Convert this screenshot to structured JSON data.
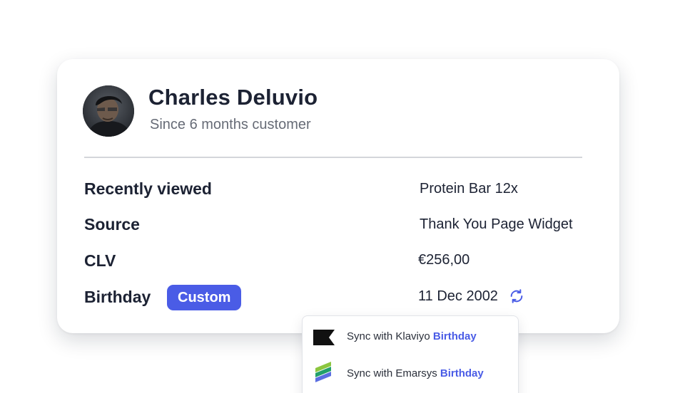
{
  "profile": {
    "name": "Charles Deluvio",
    "subtitle": "Since 6 months customer"
  },
  "fields": {
    "recently_viewed": {
      "label": "Recently viewed",
      "value": "Protein Bar 12x"
    },
    "source": {
      "label": "Source",
      "value": "Thank You Page Widget"
    },
    "clv": {
      "label": "CLV",
      "value": "€256,00"
    },
    "birthday": {
      "label": "Birthday",
      "badge": "Custom",
      "value": "11 Dec 2002"
    }
  },
  "sync_menu": {
    "items": [
      {
        "prefix": "Sync with Klaviyo",
        "field": "Birthday",
        "icon": "klaviyo-logo-icon"
      },
      {
        "prefix": "Sync with Emarsys",
        "field": "Birthday",
        "icon": "emarsys-logo-icon"
      }
    ]
  },
  "icons": {
    "sync": "sync-icon",
    "avatar": "avatar"
  },
  "colors": {
    "accent": "#4a5ce6",
    "text_primary": "#1c2233",
    "text_secondary": "#666b76",
    "divider": "#d4d6da"
  }
}
